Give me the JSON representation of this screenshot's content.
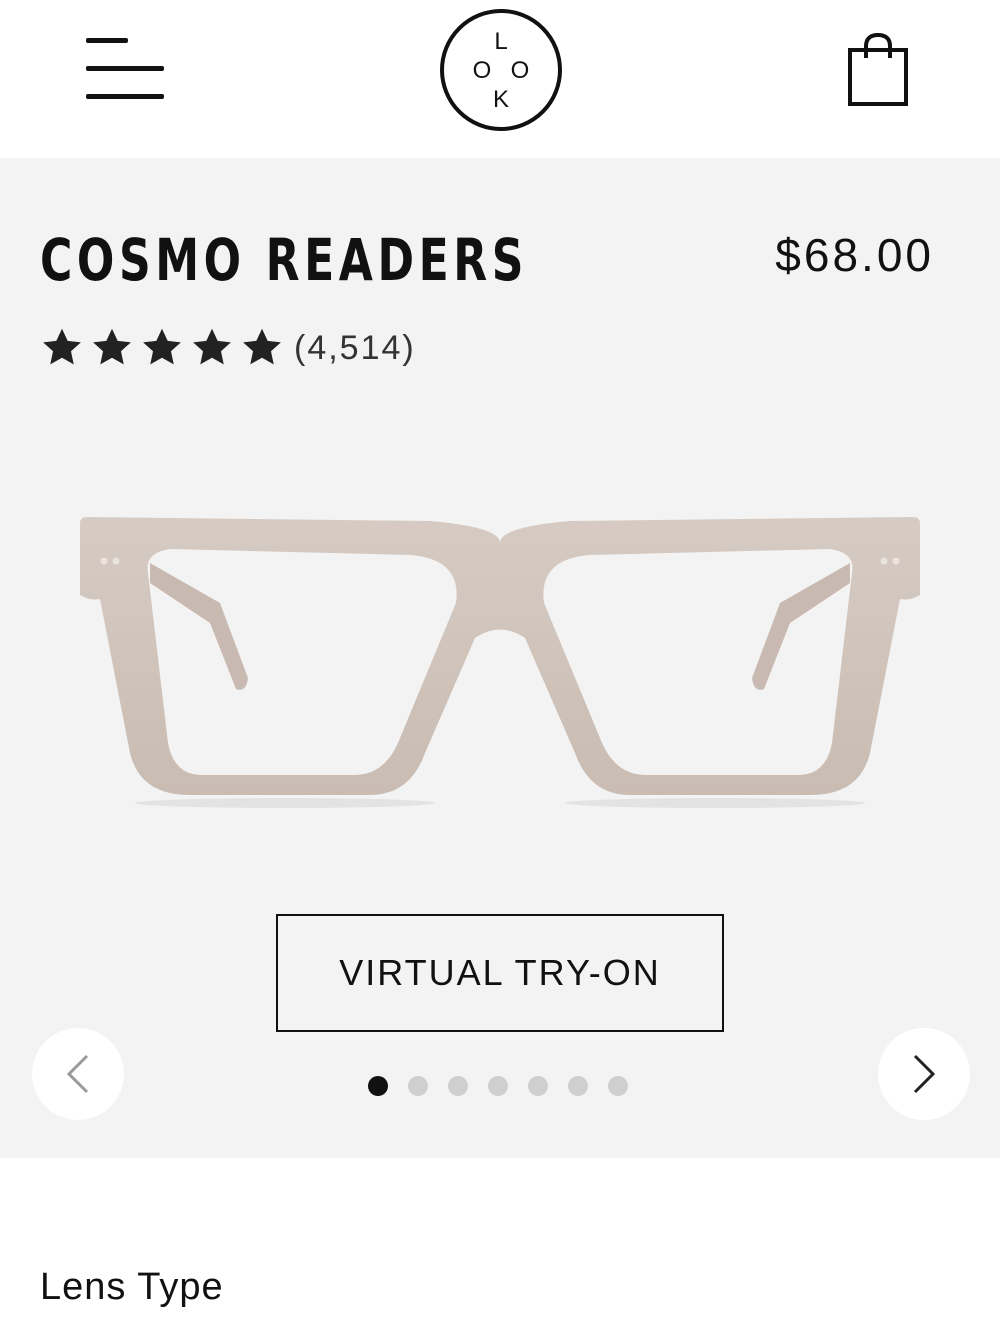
{
  "header": {
    "logo_letters": [
      "L",
      "O",
      "O",
      "K"
    ],
    "menu_icon": "hamburger-menu-icon",
    "cart_icon": "shopping-bag-icon"
  },
  "product": {
    "name": "COSMO READERS",
    "price": "$68.00",
    "rating": {
      "stars_filled": 5,
      "stars_total": 5,
      "count_label": "(4,514)"
    },
    "image_subject": "frosted taupe rectangular eyeglasses",
    "try_on_label": "VIRTUAL TRY-ON",
    "carousel": {
      "total_slides": 7,
      "active_index": 0,
      "prev_icon": "chevron-left-icon",
      "next_icon": "chevron-right-icon"
    }
  },
  "options": {
    "lens_type_label": "Lens Type"
  },
  "colors": {
    "text": "#111111",
    "product_bg": "#f3f3f3",
    "frame": "#cdc1b8",
    "dot_inactive": "#cfcfcf",
    "dot_active": "#111111"
  }
}
